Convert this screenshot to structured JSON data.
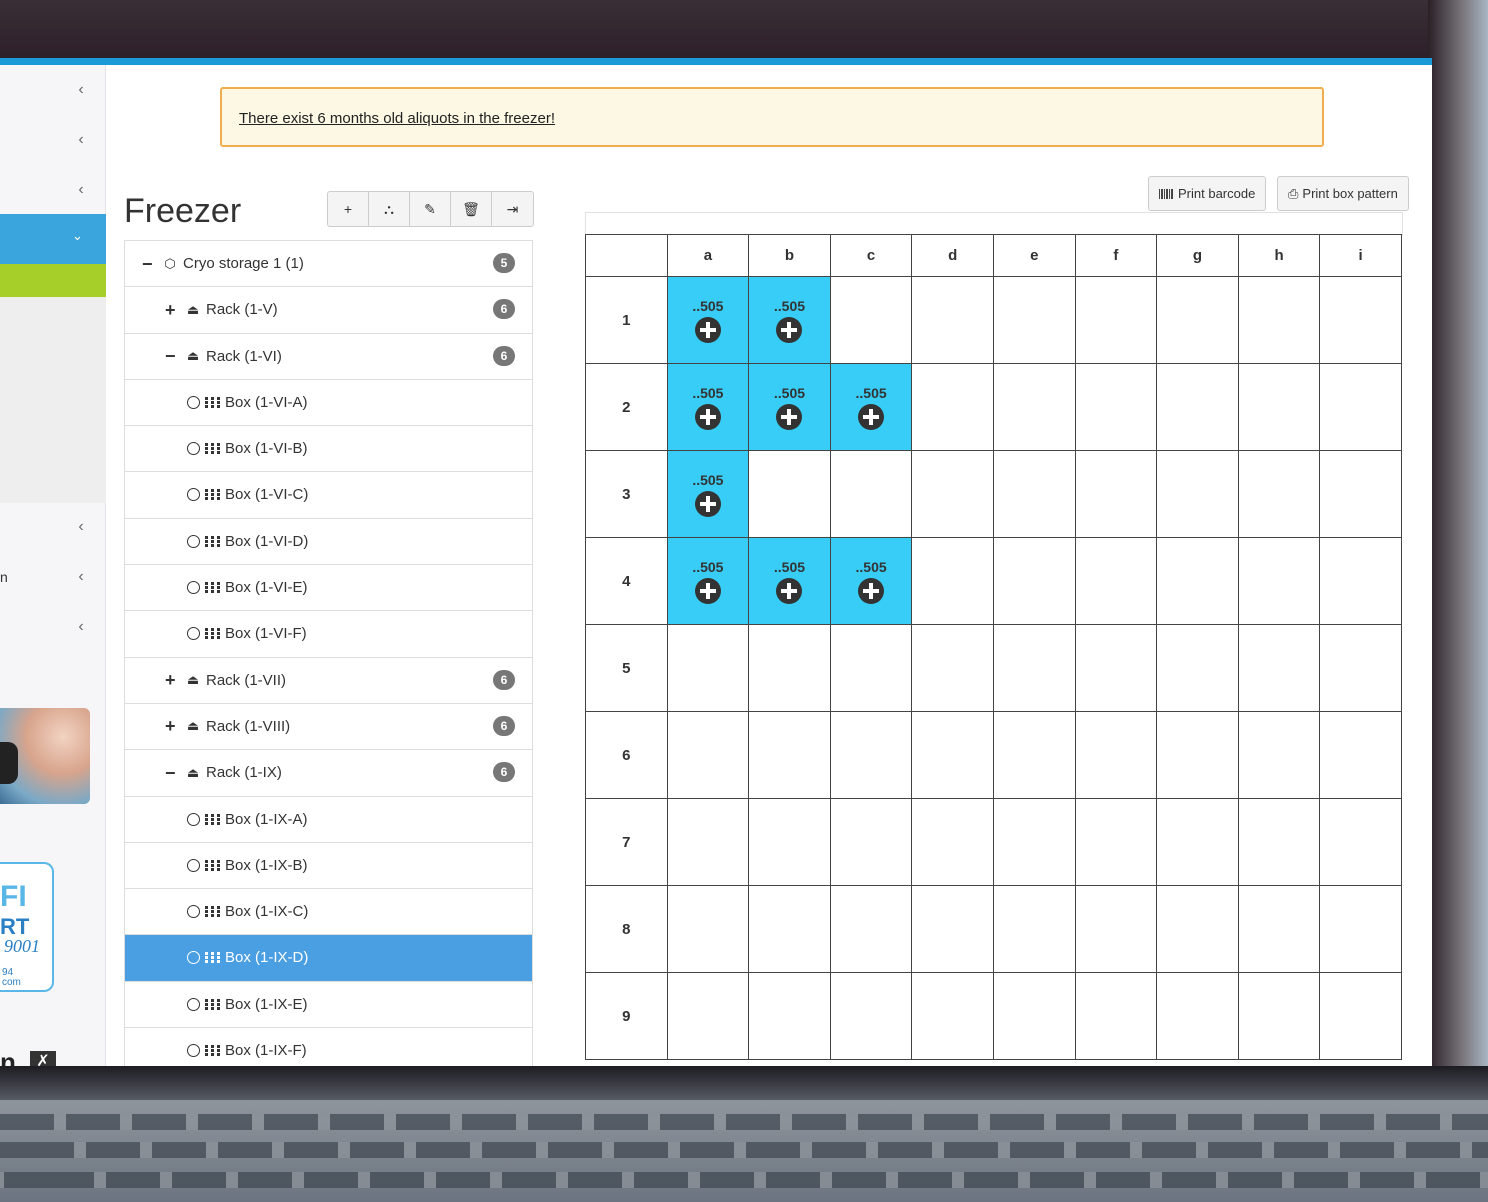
{
  "alert": {
    "text": "There exist 6 months old aliquots in the freezer!"
  },
  "page": {
    "title": "Freezer"
  },
  "toolbar": {
    "buttons": [
      {
        "icon": "plus-icon",
        "glyph": "+"
      },
      {
        "icon": "sitemap-icon",
        "glyph": "⛬"
      },
      {
        "icon": "pencil-icon",
        "glyph": "✎"
      },
      {
        "icon": "trash-icon",
        "glyph": "🗑"
      },
      {
        "icon": "sign-in-icon",
        "glyph": "⇥"
      }
    ],
    "print_barcode": "Print barcode",
    "print_box_pattern": "Print box pattern"
  },
  "sidebar": {
    "truncated_text": "n",
    "bottom_text": "n",
    "cert": {
      "line1": "FI",
      "line2": "RT",
      "line3": "9001",
      "line4": "94",
      "line5": "com"
    },
    "colors": {
      "active": "#3aa4dc",
      "green": "#a6cf2a"
    }
  },
  "tree": [
    {
      "label": "Cryo storage 1 (1)",
      "type": "storage",
      "toggle": "−",
      "badge": "5",
      "level": 0
    },
    {
      "label": "Rack (1-V)",
      "type": "rack",
      "toggle": "+",
      "badge": "6",
      "level": 1
    },
    {
      "label": "Rack (1-VI)",
      "type": "rack",
      "toggle": "−",
      "badge": "6",
      "level": 1
    },
    {
      "label": "Box (1-VI-A)",
      "type": "box",
      "level": 2
    },
    {
      "label": "Box (1-VI-B)",
      "type": "box",
      "level": 2
    },
    {
      "label": "Box (1-VI-C)",
      "type": "box",
      "level": 2
    },
    {
      "label": "Box (1-VI-D)",
      "type": "box",
      "level": 2
    },
    {
      "label": "Box (1-VI-E)",
      "type": "box",
      "level": 2
    },
    {
      "label": "Box (1-VI-F)",
      "type": "box",
      "level": 2
    },
    {
      "label": "Rack (1-VII)",
      "type": "rack",
      "toggle": "+",
      "badge": "6",
      "level": 1
    },
    {
      "label": "Rack (1-VIII)",
      "type": "rack",
      "toggle": "+",
      "badge": "6",
      "level": 1
    },
    {
      "label": "Rack (1-IX)",
      "type": "rack",
      "toggle": "−",
      "badge": "6",
      "level": 1
    },
    {
      "label": "Box (1-IX-A)",
      "type": "box",
      "level": 2
    },
    {
      "label": "Box (1-IX-B)",
      "type": "box",
      "level": 2
    },
    {
      "label": "Box (1-IX-C)",
      "type": "box",
      "level": 2
    },
    {
      "label": "Box (1-IX-D)",
      "type": "box",
      "level": 2,
      "selected": true
    },
    {
      "label": "Box (1-IX-E)",
      "type": "box",
      "level": 2
    },
    {
      "label": "Box (1-IX-F)",
      "type": "box",
      "level": 2
    }
  ],
  "grid": {
    "columns": [
      "a",
      "b",
      "c",
      "d",
      "e",
      "f",
      "g",
      "h",
      "i"
    ],
    "rows": [
      "1",
      "2",
      "3",
      "4",
      "5",
      "6",
      "7",
      "8",
      "9"
    ],
    "filled_color": "#38cdf7",
    "filled": [
      {
        "row": "1",
        "col": "a",
        "label": "..505"
      },
      {
        "row": "1",
        "col": "b",
        "label": "..505"
      },
      {
        "row": "2",
        "col": "a",
        "label": "..505"
      },
      {
        "row": "2",
        "col": "b",
        "label": "..505"
      },
      {
        "row": "2",
        "col": "c",
        "label": "..505"
      },
      {
        "row": "3",
        "col": "a",
        "label": "..505"
      },
      {
        "row": "4",
        "col": "a",
        "label": "..505"
      },
      {
        "row": "4",
        "col": "b",
        "label": "..505"
      },
      {
        "row": "4",
        "col": "c",
        "label": "..505"
      }
    ]
  }
}
